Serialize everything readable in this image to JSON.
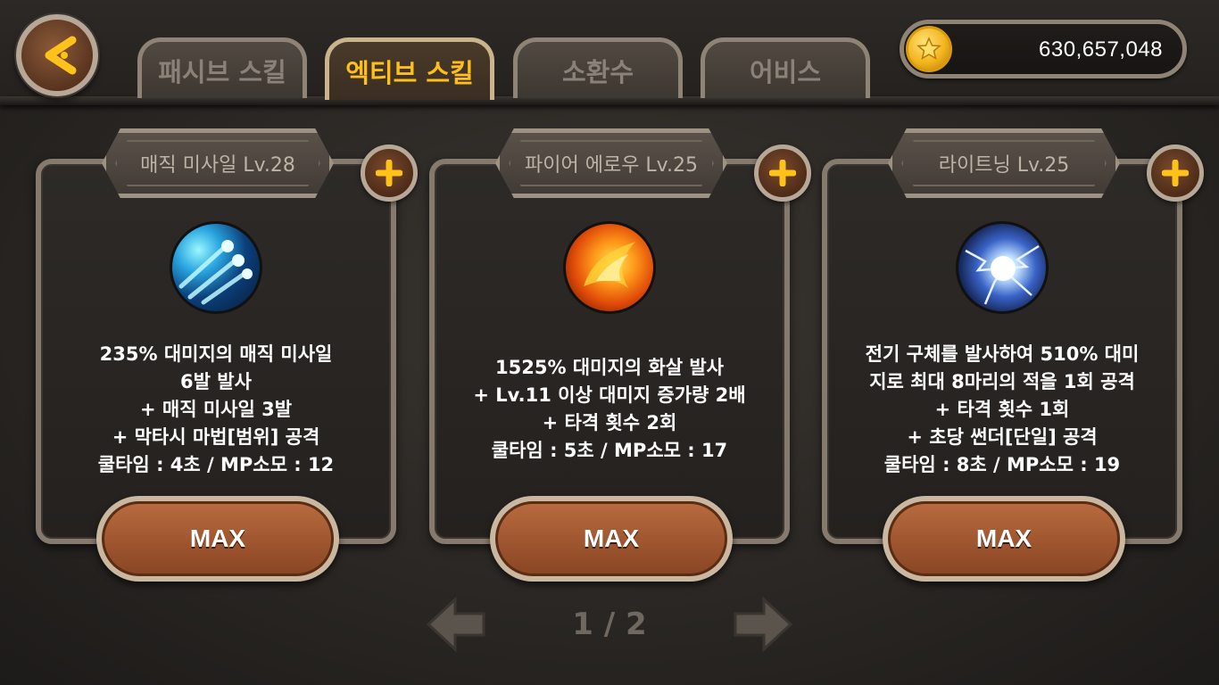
{
  "header": {
    "back_icon": "back-arrow-icon",
    "tabs": [
      {
        "label": "패시브 스킬",
        "active": false
      },
      {
        "label": "엑티브 스킬",
        "active": true
      },
      {
        "label": "소환수",
        "active": false
      },
      {
        "label": "어비스",
        "active": false
      }
    ],
    "gold": {
      "icon": "gold-coin-icon",
      "amount": "630,657,048"
    }
  },
  "skills": [
    {
      "title": "매직 미사일 Lv.28",
      "icon": "magic-missile-icon",
      "desc": [
        "235% 대미지의 매직 미사일",
        "6발 발사",
        "+ 매직 미사일 3발",
        "+ 막타시 마법[범위] 공격",
        "쿨타임 : 4초 / MP소모 : 12"
      ],
      "button": "MAX"
    },
    {
      "title": "파이어 에로우 Lv.25",
      "icon": "fire-arrow-icon",
      "desc": [
        "1525% 대미지의 화살 발사",
        "+ Lv.11 이상 대미지 증가량 2배",
        "+ 타격 횟수 2회",
        "쿨타임 : 5초 / MP소모 : 17"
      ],
      "button": "MAX"
    },
    {
      "title": "라이트닝 Lv.25",
      "icon": "lightning-icon",
      "desc": [
        "전기 구체를 발사하여 510% 대미",
        "지로 최대 8마리의 적을 1회 공격",
        "+ 타격 횟수 1회",
        "+ 초당 썬더[단일] 공격",
        "쿨타임 : 8초 / MP소모 : 19"
      ],
      "button": "MAX"
    }
  ],
  "pagination": {
    "text": "1 / 2"
  },
  "colors": {
    "accent": "#ffbf1a",
    "button": "#a55a32",
    "frame": "#857a6d"
  }
}
